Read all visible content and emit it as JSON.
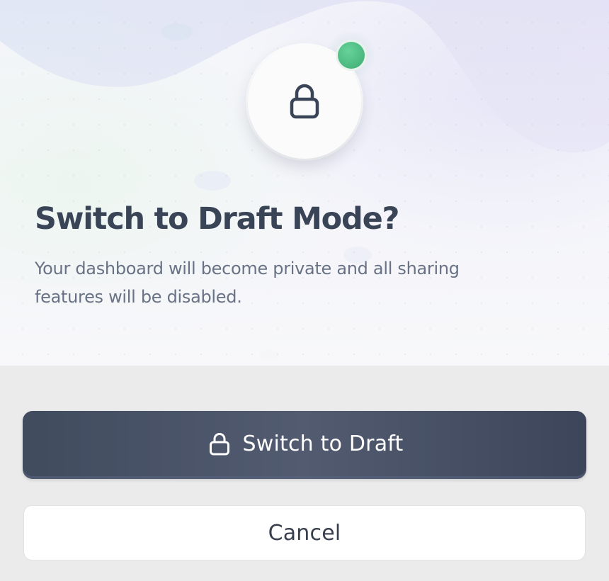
{
  "dialog": {
    "title": "Switch to Draft Mode?",
    "description": "Your dashboard will become private and all sharing features will be disabled.",
    "icon": "lock-icon",
    "status_indicator_color": "#4dbb82"
  },
  "actions": {
    "primary_label": "Switch to Draft",
    "primary_icon": "lock-icon",
    "secondary_label": "Cancel"
  },
  "colors": {
    "title": "#3a4457",
    "description": "#697285",
    "primary_button": "#485266",
    "secondary_button": "#ffffff",
    "background": "#ebebeb"
  }
}
